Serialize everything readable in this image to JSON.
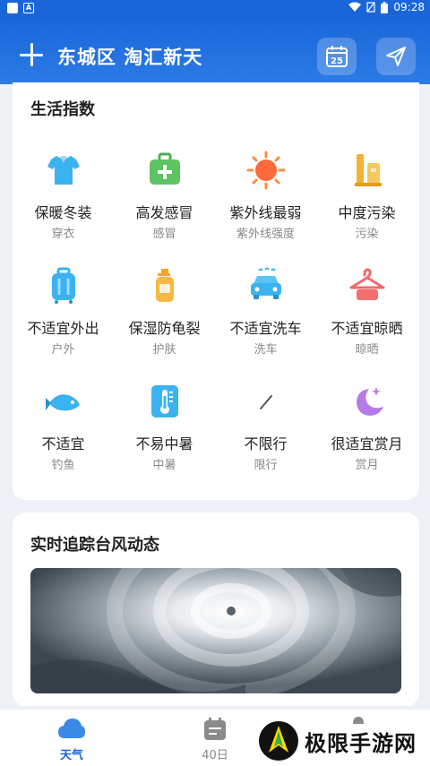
{
  "status_bar": {
    "time": "09:28"
  },
  "header": {
    "location": "东城区 淘汇新天",
    "calendar_day": "25"
  },
  "life_index": {
    "title": "生活指数",
    "items": [
      {
        "main": "保暖冬装",
        "sub": "穿衣",
        "icon": "shirt-icon"
      },
      {
        "main": "高发感冒",
        "sub": "感冒",
        "icon": "medkit-icon"
      },
      {
        "main": "紫外线最弱",
        "sub": "紫外线强度",
        "icon": "sun-icon"
      },
      {
        "main": "中度污染",
        "sub": "污染",
        "icon": "factory-icon"
      },
      {
        "main": "不适宜外出",
        "sub": "户外",
        "icon": "luggage-icon"
      },
      {
        "main": "保湿防龟裂",
        "sub": "护肤",
        "icon": "lotion-icon"
      },
      {
        "main": "不适宜洗车",
        "sub": "洗车",
        "icon": "car-wash-icon"
      },
      {
        "main": "不适宜晾晒",
        "sub": "晾晒",
        "icon": "hanger-icon"
      },
      {
        "main": "不适宜",
        "sub": "钓鱼",
        "icon": "fish-icon"
      },
      {
        "main": "不易中暑",
        "sub": "中暑",
        "icon": "thermometer-icon"
      },
      {
        "main": "不限行",
        "sub": "限行",
        "icon": "slash-icon"
      },
      {
        "main": "很适宜赏月",
        "sub": "赏月",
        "icon": "moon-icon"
      }
    ]
  },
  "typhoon": {
    "title": "实时追踪台风动态"
  },
  "bottom_nav": {
    "tabs": [
      {
        "label": "天气",
        "icon": "cloud-icon",
        "active": true
      },
      {
        "label": "40日",
        "icon": "calendar-icon",
        "active": false
      }
    ]
  },
  "watermark": {
    "text": "极限手游网"
  },
  "colors": {
    "primary": "#1a66d9",
    "card_bg": "#ffffff",
    "page_bg": "#eef1f5"
  }
}
